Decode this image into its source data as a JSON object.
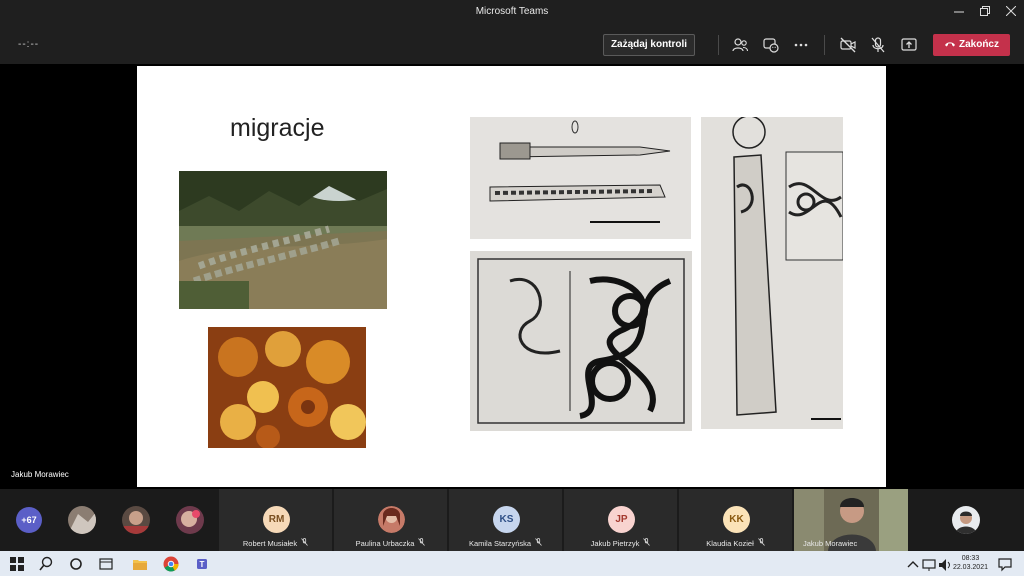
{
  "window": {
    "title": "Microsoft Teams",
    "minimize_icon": "minimize-icon",
    "maximize_icon": "restore-icon",
    "close_icon": "close-icon"
  },
  "toolbar": {
    "timer": "--:--",
    "request_control_label": "Zażądaj kontroli",
    "end_call_label": "Zakończ",
    "icons": [
      "participants-icon",
      "chat-reactions-icon",
      "more-options-icon",
      "camera-off-icon",
      "mic-off-icon",
      "share-screen-icon",
      "phone-hangup-icon"
    ],
    "end_color": "#c4314b"
  },
  "stage": {
    "presenter_name": "Jakub Morawiec",
    "slide": {
      "title": "migracje"
    }
  },
  "participants": {
    "more_count": "+67",
    "tiles": [
      {
        "initials": "RM",
        "name": "Robert Musiałek"
      },
      {
        "initials": "",
        "name": "Paulina Urbaczka"
      },
      {
        "initials": "KS",
        "name": "Kamila Starzyńska"
      },
      {
        "initials": "JP",
        "name": "Jakub Pietrzyk"
      },
      {
        "initials": "KK",
        "name": "Klaudia Kozieł"
      },
      {
        "initials": "",
        "name": "Jakub Morawiec"
      }
    ]
  },
  "taskbar": {
    "icons": [
      "windows-start-icon",
      "search-icon",
      "cortana-icon",
      "task-view-icon",
      "file-explorer-icon",
      "chrome-icon",
      "teams-icon"
    ],
    "time": "08:33",
    "date": "22.03.2021"
  }
}
